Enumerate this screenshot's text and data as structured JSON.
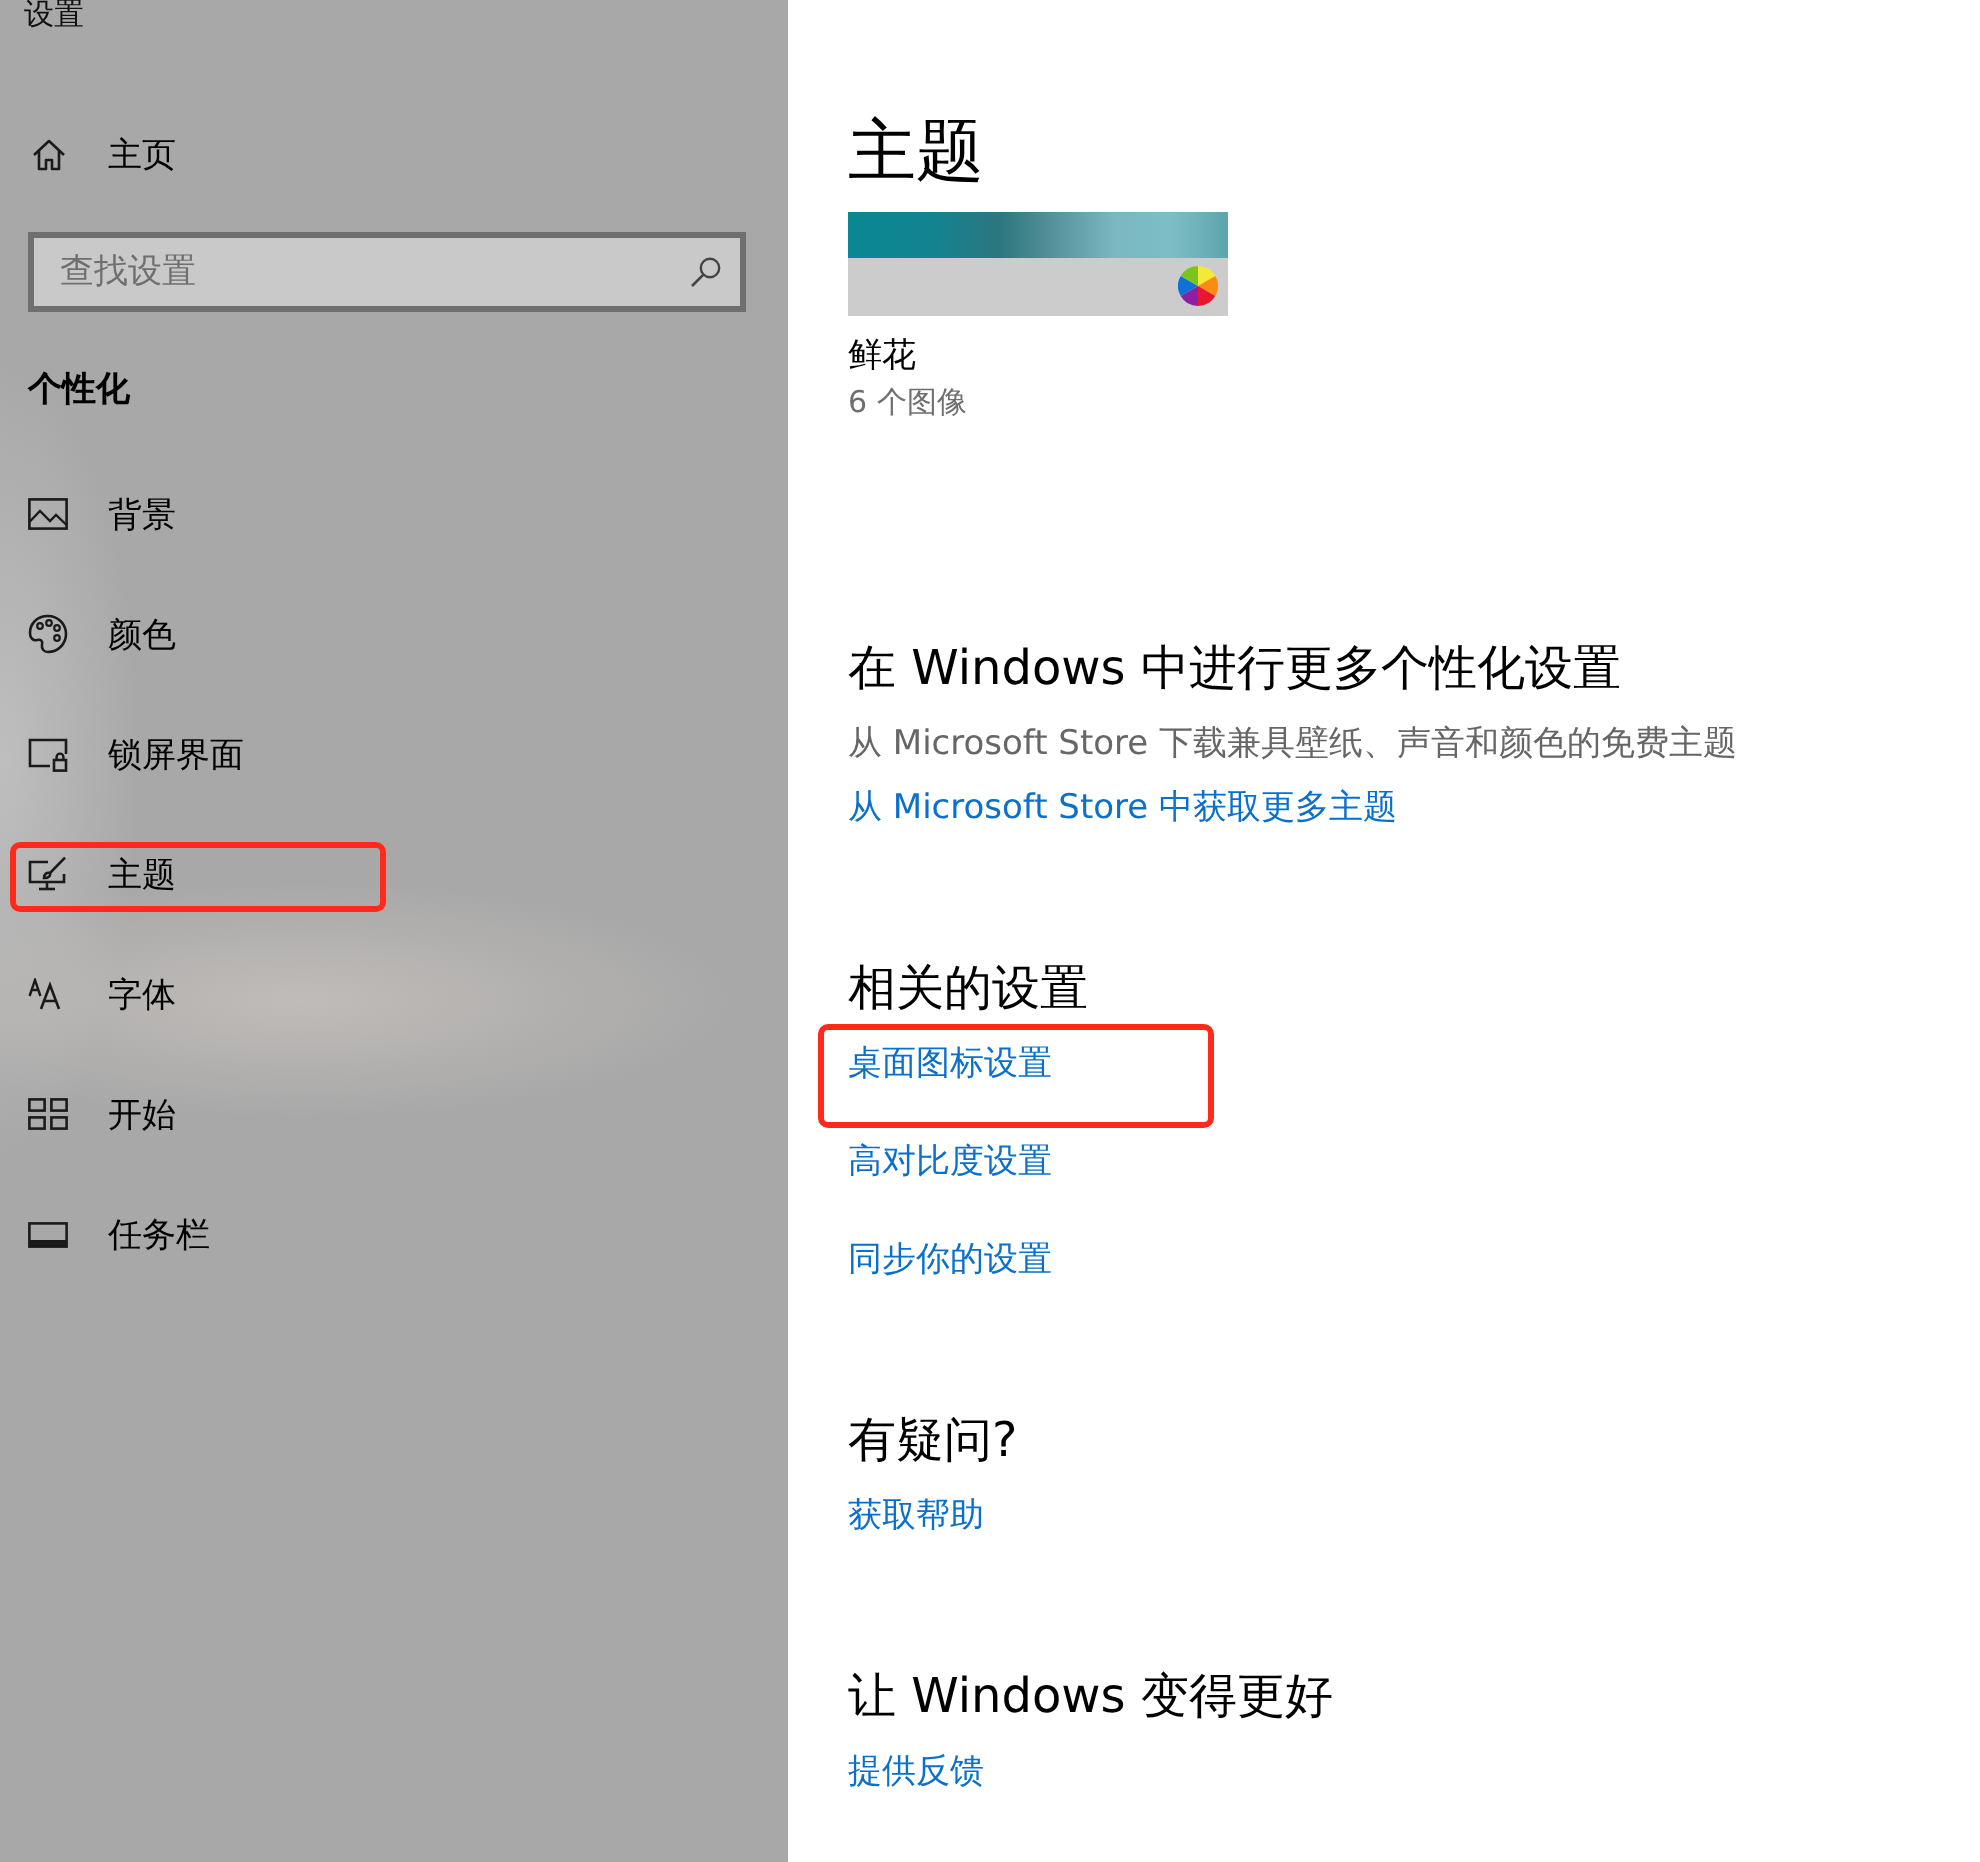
{
  "window": {
    "title": "设置"
  },
  "sidebar": {
    "home": {
      "label": "主页"
    },
    "search": {
      "placeholder": "查找设置"
    },
    "section_title": "个性化",
    "items": [
      {
        "label": "背景",
        "highlighted": false
      },
      {
        "label": "颜色",
        "highlighted": false
      },
      {
        "label": "锁屏界面",
        "highlighted": false
      },
      {
        "label": "主题",
        "highlighted": true
      },
      {
        "label": "字体",
        "highlighted": false
      },
      {
        "label": "开始",
        "highlighted": false
      },
      {
        "label": "任务栏",
        "highlighted": false
      }
    ]
  },
  "main": {
    "title": "主题",
    "theme": {
      "name": "鲜花",
      "count": "6 个图像"
    },
    "sections": [
      {
        "heading": "在 Windows 中进行更多个性化设置",
        "description": "从 Microsoft Store 下载兼具壁纸、声音和颜色的免费主题",
        "links": [
          {
            "label": "从 Microsoft Store 中获取更多主题",
            "highlighted": false
          }
        ]
      },
      {
        "heading": "相关的设置",
        "links": [
          {
            "label": "桌面图标设置",
            "highlighted": true
          },
          {
            "label": "高对比度设置",
            "highlighted": false
          },
          {
            "label": "同步你的设置",
            "highlighted": false
          }
        ]
      },
      {
        "heading": "有疑问?",
        "links": [
          {
            "label": "获取帮助",
            "highlighted": false
          }
        ]
      },
      {
        "heading": "让 Windows 变得更好",
        "links": [
          {
            "label": "提供反馈",
            "highlighted": false
          }
        ]
      }
    ]
  }
}
